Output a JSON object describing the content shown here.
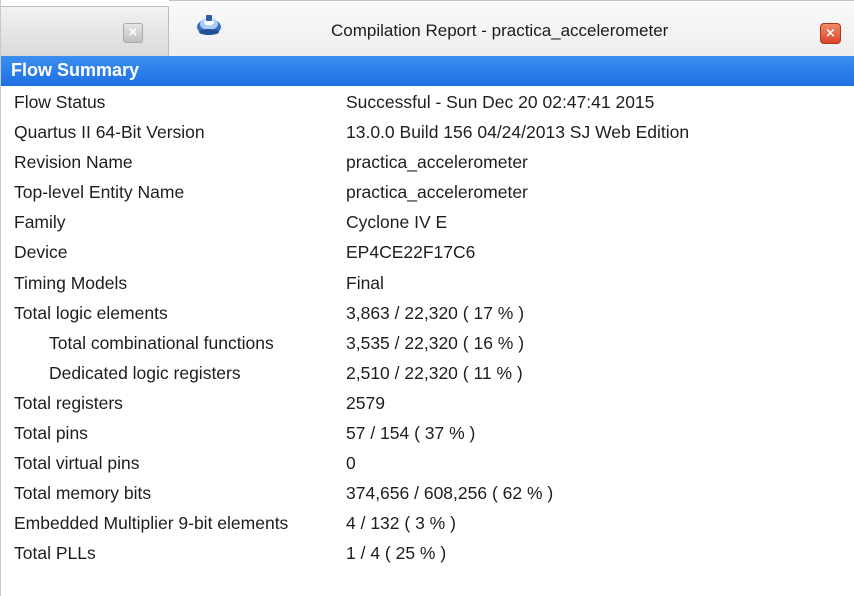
{
  "window": {
    "title": "Compilation Report - practica_accelerometer",
    "inactive_tab_close_label": "×",
    "active_tab_close_label": "×"
  },
  "section": {
    "title": "Flow Summary"
  },
  "rows": [
    {
      "label": "Flow Status",
      "value": "Successful - Sun Dec 20 02:47:41 2015"
    },
    {
      "label": "Quartus II 64-Bit Version",
      "value": "13.0.0 Build 156 04/24/2013 SJ Web Edition"
    },
    {
      "label": "Revision Name",
      "value": "practica_accelerometer"
    },
    {
      "label": "Top-level Entity Name",
      "value": "practica_accelerometer"
    },
    {
      "label": "Family",
      "value": "Cyclone IV E"
    },
    {
      "label": "Device",
      "value": "EP4CE22F17C6"
    },
    {
      "label": "Timing Models",
      "value": "Final"
    },
    {
      "label": "Total logic elements",
      "value": "3,863 / 22,320 ( 17 % )"
    },
    {
      "label": "Total combinational functions",
      "value": "3,535 / 22,320 ( 16 % )"
    },
    {
      "label": "Dedicated logic registers",
      "value": "2,510 / 22,320 ( 11 % )"
    },
    {
      "label": "Total registers",
      "value": "2579"
    },
    {
      "label": "Total pins",
      "value": "57 / 154 ( 37 % )"
    },
    {
      "label": "Total virtual pins",
      "value": "0"
    },
    {
      "label": "Total memory bits",
      "value": "374,656 / 608,256 ( 62 % )"
    },
    {
      "label": "Embedded Multiplier 9-bit elements",
      "value": "4 / 132 ( 3 % )"
    },
    {
      "label": "Total PLLs",
      "value": "1 / 4 ( 25 % )"
    }
  ],
  "icons": {
    "report_icon": "report-icon",
    "close_icon": "close-icon"
  },
  "colors": {
    "header_bg": "#1e6fe2",
    "close_active": "#d9462a"
  }
}
